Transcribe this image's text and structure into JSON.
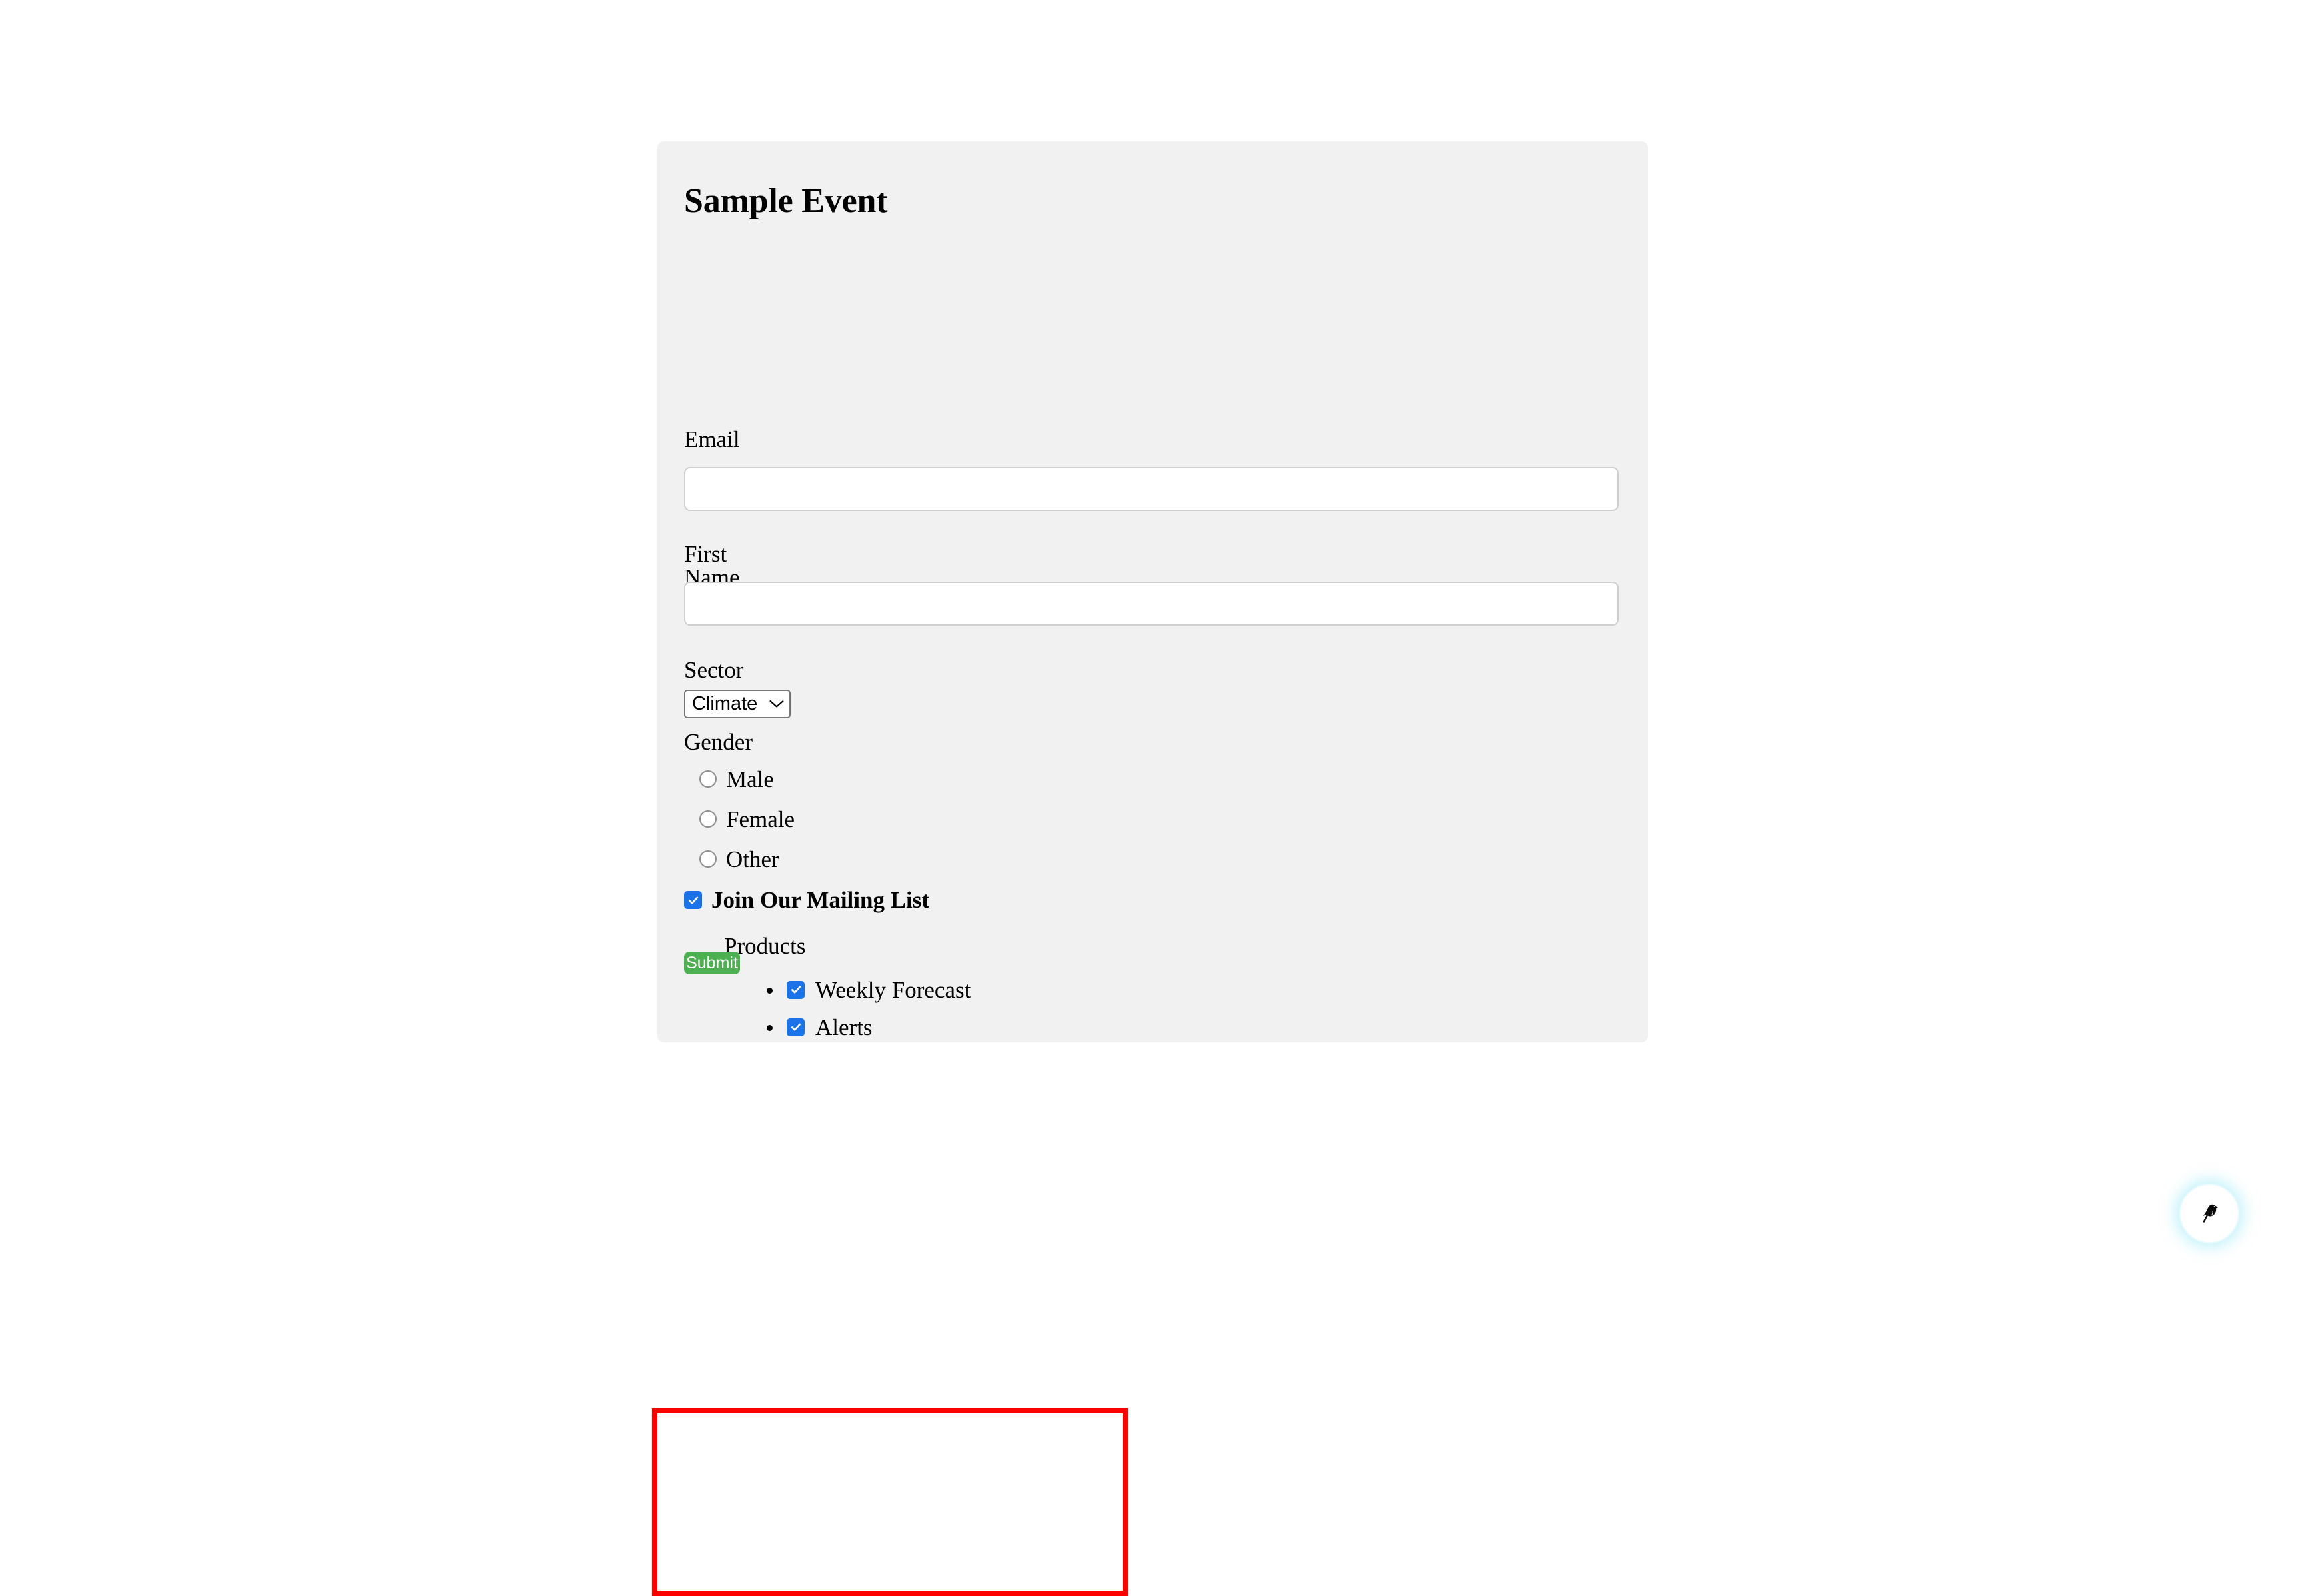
{
  "page": {
    "background_color": "#ffffff"
  },
  "card": {
    "background_color": "#f1f1f1",
    "title": "Sample Event"
  },
  "form": {
    "email": {
      "label": "Email",
      "value": "",
      "placeholder": ""
    },
    "first_name": {
      "label": "First Name",
      "value": "",
      "placeholder": ""
    },
    "sector": {
      "label": "Sector",
      "selected": "Climate",
      "icon": "chevron-down-icon"
    },
    "gender": {
      "label": "Gender",
      "options": [
        {
          "label": "Male",
          "checked": false
        },
        {
          "label": "Female",
          "checked": false
        },
        {
          "label": "Other",
          "checked": false
        }
      ]
    },
    "mailing_list": {
      "label": "Join Our Mailing List",
      "checked": true,
      "highlight_color": "#ff0000",
      "products_label": "Products",
      "products": [
        {
          "label": "Weekly Forecast",
          "checked": true
        },
        {
          "label": "Alerts",
          "checked": true
        }
      ]
    },
    "submit": {
      "label": "Submit",
      "color": "#4caf50"
    }
  },
  "widget": {
    "icon": "bird-icon",
    "glow_color": "#96e8f5"
  }
}
